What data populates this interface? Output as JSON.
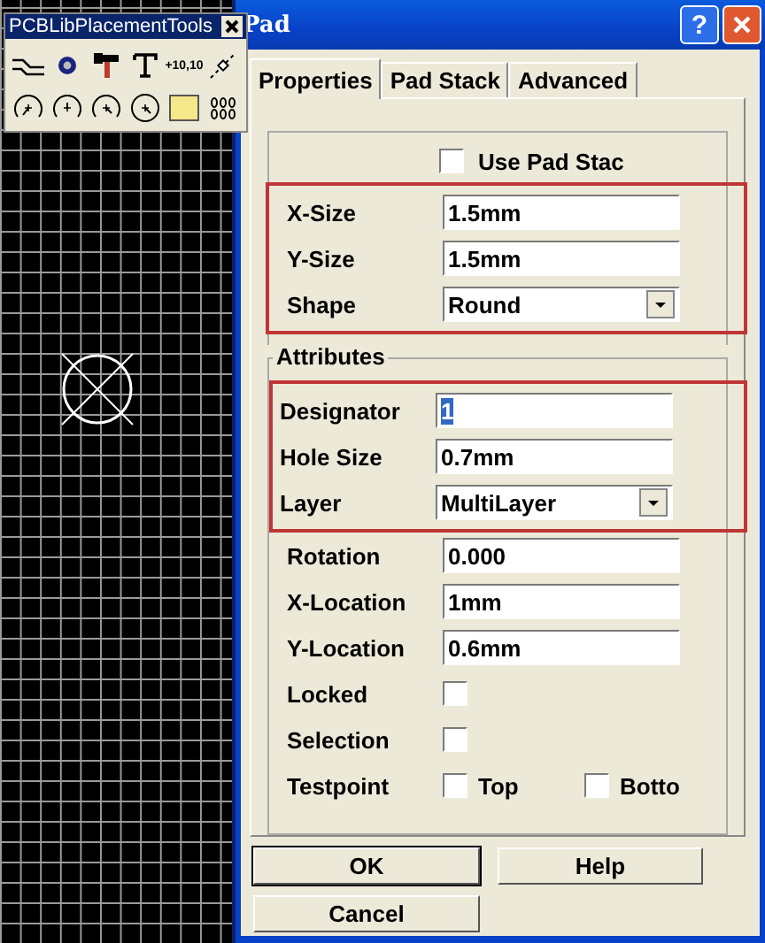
{
  "toolbar": {
    "title": "PCBLibPlacementTools",
    "tools": [
      {
        "kind": "track"
      },
      {
        "kind": "via"
      },
      {
        "kind": "pad"
      },
      {
        "kind": "text"
      },
      {
        "kind": "coordinate",
        "label": "+10,10"
      },
      {
        "kind": "dimension"
      },
      {
        "kind": "arc-edge"
      },
      {
        "kind": "arc-center"
      },
      {
        "kind": "arc-any"
      },
      {
        "kind": "circle"
      },
      {
        "kind": "fill"
      },
      {
        "kind": "array"
      }
    ]
  },
  "canvas": {
    "pad_symbol": true
  },
  "dialog": {
    "title": "Pad",
    "help_button": "?",
    "tabs": [
      {
        "label": "Properties",
        "selected": true
      },
      {
        "label": "Pad Stack",
        "selected": false
      },
      {
        "label": "Advanced",
        "selected": false
      }
    ],
    "use_pad_stack": {
      "label": "Use Pad Stac",
      "checked": false
    },
    "size_rows": {
      "highlighted": true,
      "rows": [
        {
          "kind": "field",
          "label": "X-Size",
          "value": "1.5mm"
        },
        {
          "kind": "field",
          "label": "Y-Size",
          "value": "1.5mm"
        },
        {
          "kind": "dropdown",
          "label": "Shape",
          "value": "Round"
        }
      ]
    },
    "attributes": {
      "legend": "Attributes",
      "highlighted_rows": {
        "highlighted": true,
        "rows": [
          {
            "kind": "field",
            "label": "Designator",
            "value": "1",
            "text_selected": true
          },
          {
            "kind": "field",
            "label": "Hole Size",
            "value": "0.7mm",
            "text_selected": false
          },
          {
            "kind": "dropdown",
            "label": "Layer",
            "value": "MultiLayer"
          }
        ]
      },
      "rows": [
        {
          "kind": "field",
          "label": "Rotation",
          "value": "0.000"
        },
        {
          "kind": "field",
          "label": "X-Location",
          "value": "1mm"
        },
        {
          "kind": "field",
          "label": "Y-Location",
          "value": "0.6mm"
        },
        {
          "kind": "checkbox",
          "label": "Locked",
          "checked": false
        },
        {
          "kind": "checkbox",
          "label": "Selection",
          "checked": false
        }
      ],
      "testpoint": {
        "label": "Testpoint",
        "options": [
          {
            "label": "Top",
            "checked": false
          },
          {
            "label": "Botto",
            "checked": false
          }
        ]
      }
    },
    "buttons": [
      {
        "label": "OK",
        "default": true
      },
      {
        "label": "Help",
        "default": false
      },
      {
        "label": "Cancel",
        "default": false
      }
    ]
  }
}
